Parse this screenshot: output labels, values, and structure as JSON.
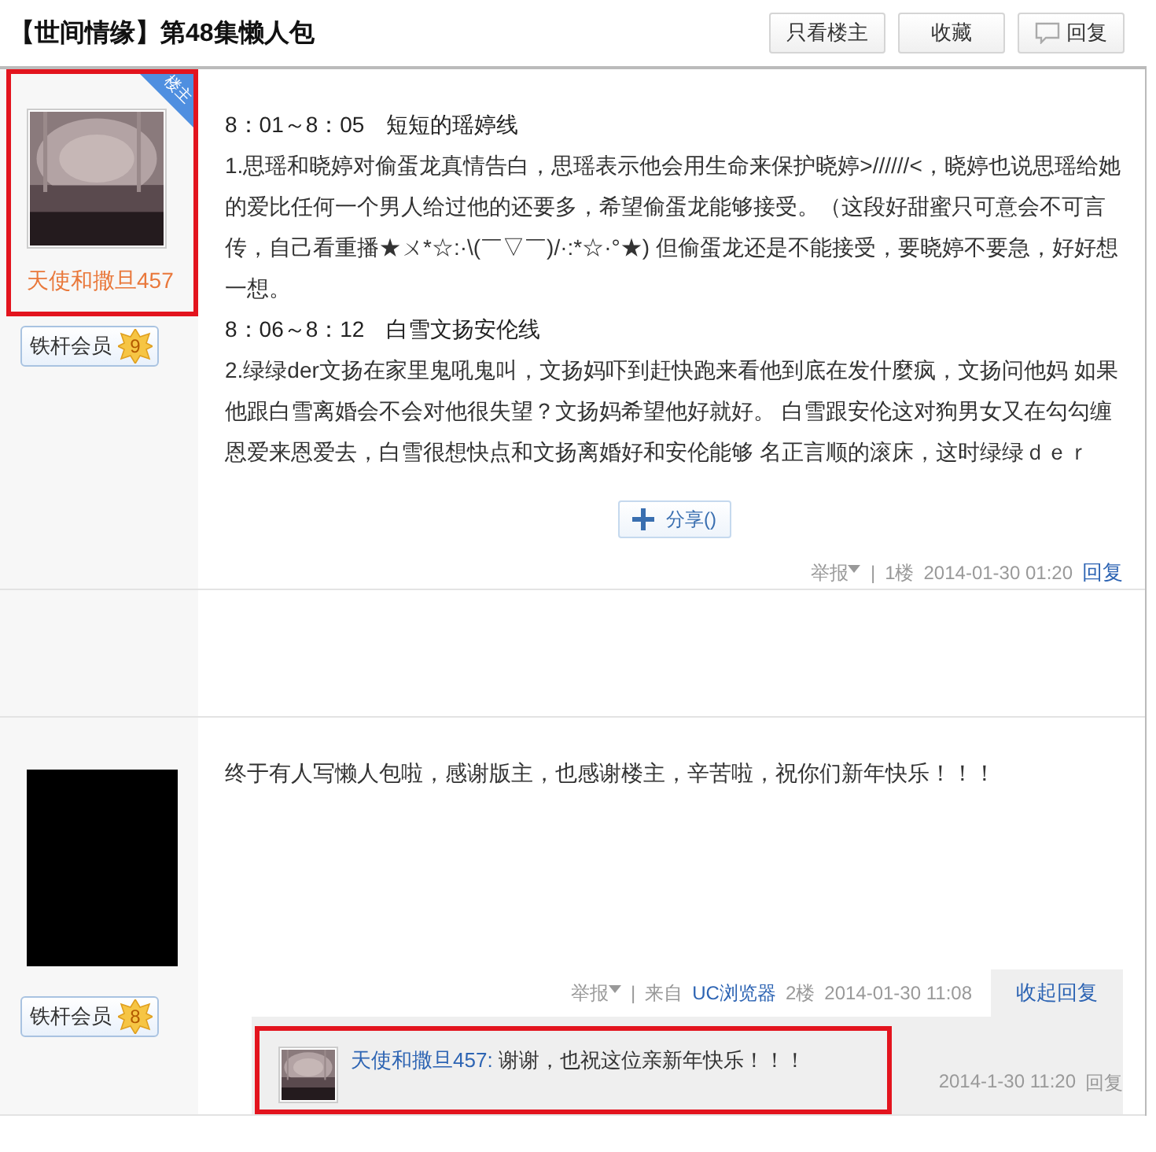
{
  "thread": {
    "title": "【世间情缘】第48集懒人包",
    "buttons": [
      {
        "label": "只看楼主",
        "kind": "plain"
      },
      {
        "label": "收藏",
        "kind": "plain"
      },
      {
        "label": "回复",
        "kind": "comment"
      }
    ]
  },
  "posts": [
    {
      "author": {
        "highlighted": true,
        "op_badge": "楼主",
        "name": "天使和撒旦457",
        "member_title": "铁杆会员",
        "level": "9"
      },
      "content": [
        {
          "kind": "heading",
          "text": "8：01～8：05　短短的瑶婷线"
        },
        {
          "kind": "paragraph",
          "text": "1.思瑶和晓婷对偷蛋龙真情告白，思瑶表示他会用生命来保护晓婷>//////<，晓婷也说思瑶给她的爱比任何一个男人给过他的还要多，希望偷蛋龙能够接受。（这段好甜蜜只可意会不可言传，自己看重播★ㄨ*☆:·\\(￣▽￣)/·:*☆·°★) 但偷蛋龙还是不能接受，要晓婷不要急，好好想一想。"
        },
        {
          "kind": "heading",
          "text": "8：06～8：12　白雪文扬安伦线"
        },
        {
          "kind": "paragraph",
          "text": "2.绿绿der文扬在家里鬼吼鬼叫，文扬妈吓到赶快跑来看他到底在发什麼疯，文扬问他妈 如果他跟白雪离婚会不会对他很失望？文扬妈希望他好就好。 白雪跟安伦这对狗男女又在勾勾缠恩爱来恩爱去，白雪很想快点和文扬离婚好和安伦能够 名正言顺的滚床，这时绿绿ｄｅｒ"
        }
      ],
      "share": "分享()",
      "footer": {
        "report": "举报",
        "separator": "|",
        "floor": "1楼",
        "time": "2014-01-30 01:20",
        "reply": "回复"
      }
    },
    {
      "author": {
        "highlighted": false,
        "avatar": {
          "kind": "blank"
        },
        "member_title": "铁杆会员",
        "level": "8"
      },
      "content": [
        {
          "kind": "paragraph",
          "text": "终于有人写懒人包啦，感谢版主，也感谢楼主，辛苦啦，祝你们新年快乐！！！"
        }
      ],
      "footer": {
        "report": "举报",
        "separator": "|",
        "source_prefix": "来自",
        "source": "UC浏览器",
        "floor": "2楼",
        "time": "2014-01-30 11:08"
      },
      "replies_toggle": {
        "label": "收起回复",
        "expanded": true
      },
      "replies": [
        {
          "highlighted": true,
          "author": "天使和撒旦457:",
          "text": "谢谢，也祝这位亲新年快乐！！！",
          "time": "2014-1-30 11:20",
          "reply": "回复"
        }
      ]
    }
  ]
}
